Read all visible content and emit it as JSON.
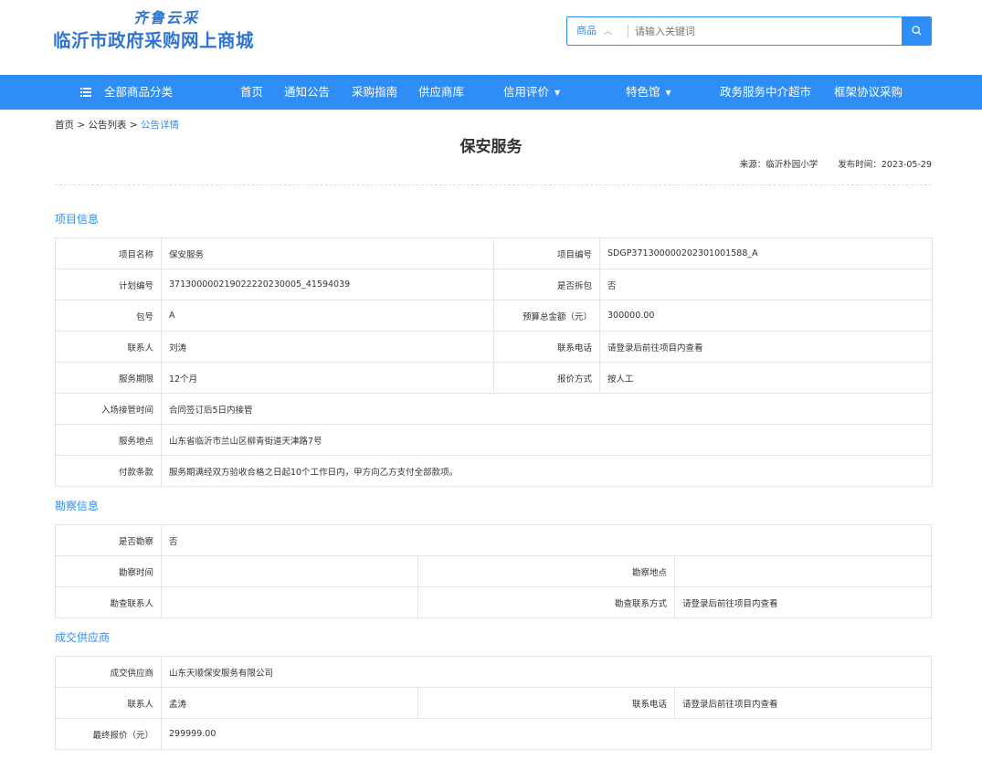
{
  "logo": {
    "top_text": "齐鲁云采",
    "main_text": "临沂市政府采购网上商城"
  },
  "search": {
    "category": "商品",
    "placeholder": "请输入关键词"
  },
  "nav": {
    "all_categories": "全部商品分类",
    "items": [
      "首页",
      "通知公告",
      "采购指南",
      "供应商库",
      "信用评价",
      "特色馆",
      "政务服务中介超市",
      "框架协议采购"
    ]
  },
  "breadcrumb": {
    "home": "首页",
    "list": "公告列表",
    "current": "公告详情",
    "separator": ">"
  },
  "article": {
    "title": "保安服务",
    "source": "来源：临沂朴园小学",
    "publish_time": "发布时间：2023-05-29"
  },
  "project": {
    "section_title": "项目信息",
    "rows": [
      {
        "l1": "项目名称",
        "v1": "保安服务",
        "l2": "项目编号",
        "v2": "SDGP371300000202301001588_A"
      },
      {
        "l1": "计划编号",
        "v1": "371300000219022220230005_41594039",
        "l2": "是否拆包",
        "v2": "否"
      },
      {
        "l1": "包号",
        "v1": "A",
        "l2": "预算总金额（元）",
        "v2": "300000.00"
      },
      {
        "l1": "联系人",
        "v1": "刘涛",
        "l2": "联系电话",
        "v2": "请登录后前往项目内查看"
      },
      {
        "l1": "服务期限",
        "v1": "12个月",
        "l2": "报价方式",
        "v2": "按人工"
      }
    ],
    "wide_rows": [
      {
        "l": "入场接管时间",
        "v": "合同签订后5日内接管"
      },
      {
        "l": "服务地点",
        "v": "山东省临沂市兰山区柳青街道天津路7号"
      },
      {
        "l": "付款条款",
        "v": "服务期满经双方验收合格之日起10个工作日内，甲方向乙方支付全部款项。"
      }
    ]
  },
  "survey": {
    "section_title": "勘察信息",
    "is_survey_label": "是否勘察",
    "is_survey_value": "否",
    "time_label": "勘察时间",
    "time_value": "",
    "place_label": "勘察地点",
    "place_value": "",
    "contact_label": "勘查联系人",
    "contact_value": "",
    "contact_method_label": "勘查联系方式",
    "contact_method_value": "请登录后前往项目内查看"
  },
  "supplier": {
    "section_title": "成交供应商",
    "name_label": "成交供应商",
    "name_value": "山东天顺保安服务有限公司",
    "contact_label": "联系人",
    "contact_value": "孟涛",
    "phone_label": "联系电话",
    "phone_value": "请登录后前往项目内查看",
    "price_label": "最终报价（元）",
    "price_value": "299999.00"
  },
  "colors": {
    "primary": "#2e8ef5",
    "logo": "#2f74d0",
    "border": "#e3e3e3"
  },
  "icons": [
    "search-icon",
    "menu-icon",
    "chevron-down-icon"
  ]
}
